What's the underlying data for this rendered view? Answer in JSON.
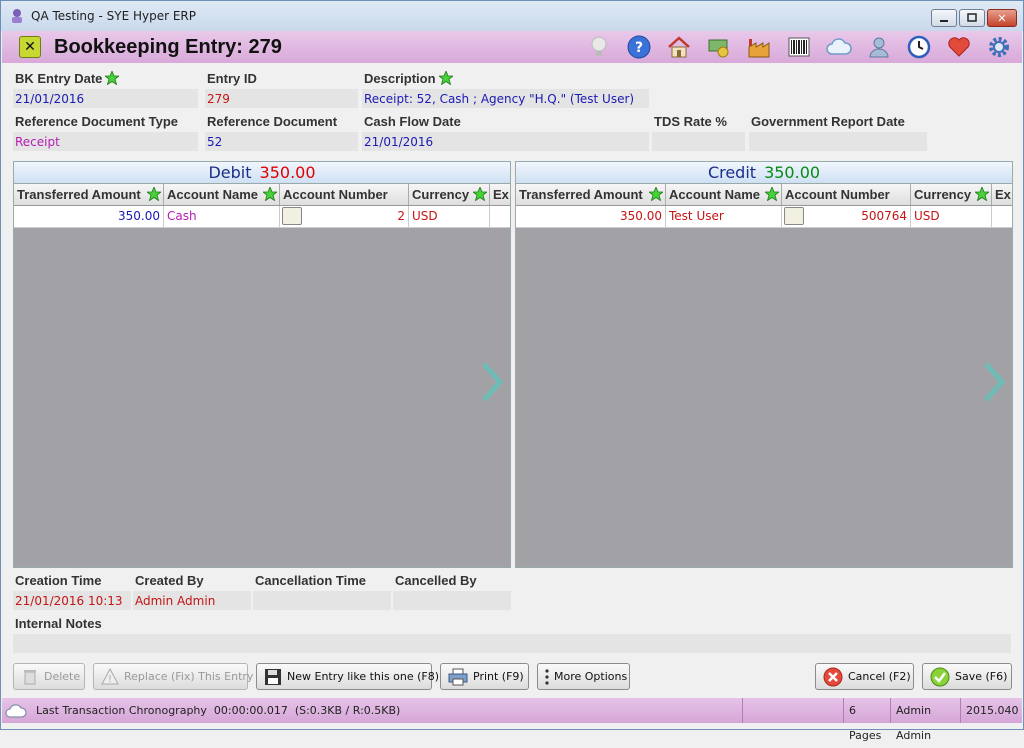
{
  "window": {
    "title": "QA Testing - SYE Hyper ERP"
  },
  "header": {
    "title": "Bookkeeping Entry: 279"
  },
  "toolbar_icons": [
    "lightbulb-icon",
    "help-icon",
    "home-icon",
    "money-icon",
    "factory-icon",
    "barcode-icon",
    "cloud-icon",
    "user-icon",
    "clock-icon",
    "heart-icon",
    "gear-icon"
  ],
  "form": {
    "bk_entry_date_label": "BK Entry Date",
    "bk_entry_date": "21/01/2016",
    "entry_id_label": "Entry ID",
    "entry_id": "279",
    "description_label": "Description",
    "description": "Receipt: 52, Cash ; Agency \"H.Q.\" (Test User)",
    "ref_doc_type_label": "Reference Document Type",
    "ref_doc_type": "Receipt",
    "ref_doc_label": "Reference Document",
    "ref_doc": "52",
    "cash_flow_date_label": "Cash Flow Date",
    "cash_flow_date": "21/01/2016",
    "tds_rate_label": "TDS Rate %",
    "tds_rate": "",
    "gov_report_date_label": "Government Report Date",
    "gov_report_date": ""
  },
  "debit": {
    "title": "Debit",
    "total": "350.00",
    "columns": [
      "Transferred Amount",
      "Account Name",
      "Account Number",
      "Currency",
      "Ex"
    ],
    "rows": [
      {
        "amount": "350.00",
        "account_name": "Cash",
        "account_number": "2",
        "currency": "USD"
      }
    ]
  },
  "credit": {
    "title": "Credit",
    "total": "350.00",
    "columns": [
      "Transferred Amount",
      "Account Name",
      "Account Number",
      "Currency",
      "Ex"
    ],
    "rows": [
      {
        "amount": "350.00",
        "account_name": "Test User",
        "account_number": "500764",
        "currency": "USD"
      }
    ]
  },
  "footer": {
    "creation_time_label": "Creation Time",
    "creation_time": "21/01/2016 10:13",
    "created_by_label": "Created By",
    "created_by": "Admin Admin",
    "cancellation_time_label": "Cancellation Time",
    "cancellation_time": "",
    "cancelled_by_label": "Cancelled By",
    "cancelled_by": "",
    "internal_notes_label": "Internal Notes",
    "internal_notes": ""
  },
  "buttons": {
    "delete": "Delete",
    "replace": "Replace (Fix) This Entry",
    "new_entry": "New Entry like this one  (F8)",
    "print": "Print  (F9)",
    "more_options": "More Options",
    "cancel": "Cancel  (F2)",
    "save": "Save  (F6)"
  },
  "status": {
    "label": "Last Transaction Chronography",
    "time": "00:00:00.017",
    "sizes": "(S:0.3KB / R:0.5KB)",
    "pages": "6 Pages",
    "user": "Admin Admin",
    "version": "2015.040"
  },
  "colors": {
    "header_bg": "#d8a9d9",
    "status_bg": "#d5a6d7",
    "debit_total": "#e00000",
    "credit_total": "#0a8a14",
    "value_blue": "#1a1ab4",
    "value_red": "#c41414"
  }
}
